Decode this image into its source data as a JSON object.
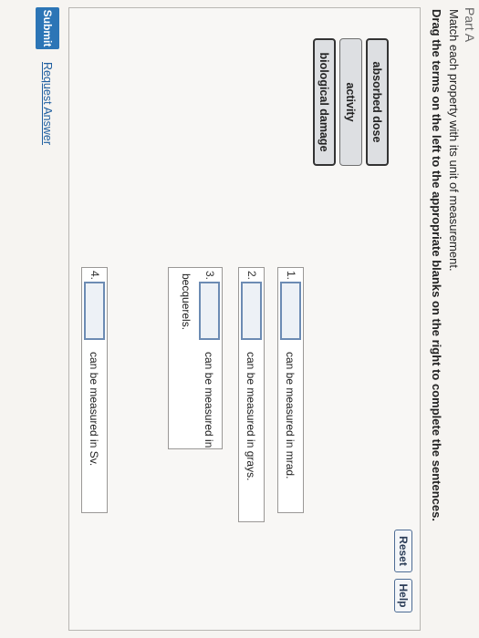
{
  "part": {
    "title": "Part A"
  },
  "instructions": {
    "line1": "Match each property with its unit of measurement.",
    "line2": "Drag the terms on the left to the appropriate blanks on the right to complete the sentences."
  },
  "controls": {
    "reset_label": "Reset",
    "help_label": "Help"
  },
  "terms": [
    {
      "label": "absorbed dose"
    },
    {
      "label": "activity"
    },
    {
      "label": "biological damage"
    }
  ],
  "sentences": [
    {
      "number": "1.",
      "text": "can be measured in mrad."
    },
    {
      "number": "2.",
      "text": "can be measured in grays."
    },
    {
      "number": "3.",
      "text": "can be measured in",
      "text_line2": "becquerels."
    },
    {
      "number": "4.",
      "text": "can be measured in Sv."
    }
  ],
  "footer": {
    "submit_label": "Submit",
    "request_label": "Request Answer"
  }
}
